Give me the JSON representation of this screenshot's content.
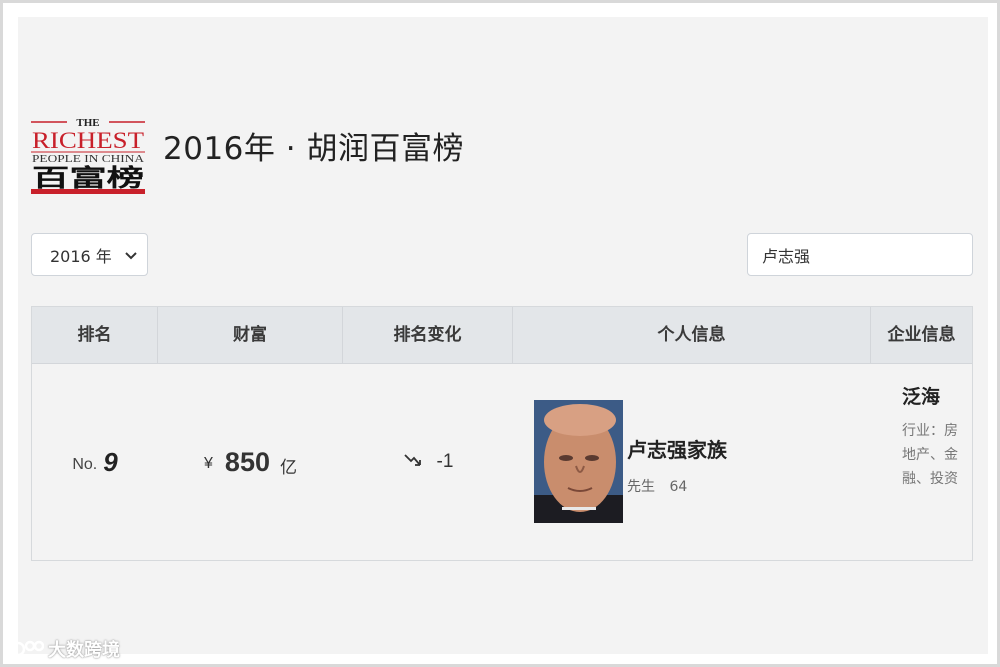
{
  "header": {
    "logo": {
      "line1": "THE",
      "line2": "RICHEST",
      "line3": "PEOPLE IN CHINA",
      "line4": "百富榜"
    },
    "title": "2016年 · 胡润百富榜"
  },
  "controls": {
    "year_selected": "2016 年",
    "search_value": "卢志强"
  },
  "table": {
    "columns": [
      "排名",
      "财富",
      "排名变化",
      "个人信息",
      "企业信息"
    ],
    "rows": [
      {
        "rank_prefix": "No.",
        "rank": "9",
        "currency": "¥",
        "wealth": "850",
        "wealth_unit": "亿",
        "change": "-1",
        "change_icon": "trend-down-icon",
        "name": "卢志强家族",
        "title": "先生",
        "age": "64",
        "company": "泛海",
        "industry": "行业：房地产、金融、投资"
      }
    ]
  },
  "watermark": "大数跨境",
  "colors": {
    "logo_red": "#c8202a",
    "header_bg": "#e3e6e9",
    "panel_bg": "#f3f3f3"
  }
}
